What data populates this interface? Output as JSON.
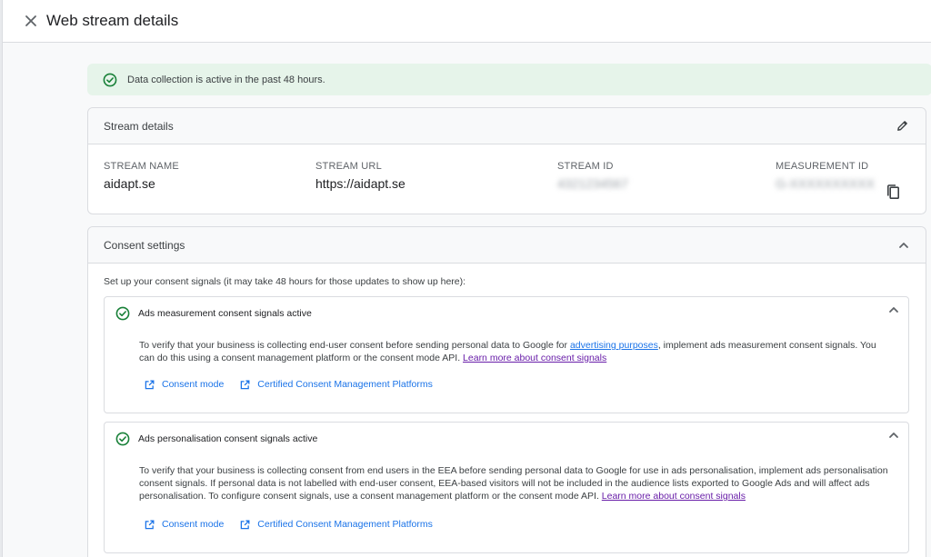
{
  "header": {
    "title": "Web stream details"
  },
  "banner": {
    "text": "Data collection is active in the past 48 hours."
  },
  "stream_details": {
    "title": "Stream details",
    "columns": [
      {
        "label": "STREAM NAME",
        "value": "aidapt.se"
      },
      {
        "label": "STREAM URL",
        "value": "https://aidapt.se"
      },
      {
        "label": "STREAM ID",
        "value": "4321234567"
      },
      {
        "label": "MEASUREMENT ID",
        "value": "G-XXXXXXXXXX"
      }
    ]
  },
  "consent": {
    "title": "Consent settings",
    "intro": "Set up your consent signals (it may take 48 hours for those updates to show up here):",
    "ads_measurement": {
      "title": "Ads measurement consent signals active",
      "text1": "To verify that your business is collecting end-user consent before sending personal data to Google for ",
      "link1": "advertising purposes",
      "text2": ", implement ads measurement consent signals. You can do this using a consent management platform or the consent mode API. ",
      "learn_more": "Learn more about consent signals",
      "consent_mode": "Consent mode",
      "cmp": "Certified Consent Management Platforms"
    },
    "ads_personalisation": {
      "title": "Ads personalisation consent signals active",
      "text1": "To verify that your business is collecting consent from end users in the EEA before sending personal data to Google for use in ads personalisation, implement ads personalisation consent signals. If personal data is not labelled with end-user consent, EEA-based visitors will not be included in the audience lists exported to Google Ads and will affect ads personalisation. To configure consent signals, use a consent management platform or the consent mode API. ",
      "learn_more": "Learn more about consent signals",
      "consent_mode": "Consent mode",
      "cmp": "Certified Consent Management Platforms"
    }
  },
  "icons": {
    "close": "close-icon",
    "check": "check-circle-icon",
    "edit": "pencil-icon",
    "copy": "copy-icon",
    "chevron": "chevron-up-icon",
    "external": "open-in-new-icon"
  },
  "colors": {
    "accent": "#1a73e8",
    "success": "#188038",
    "banner_bg": "#e6f4ea",
    "visited_link": "#681da8"
  }
}
